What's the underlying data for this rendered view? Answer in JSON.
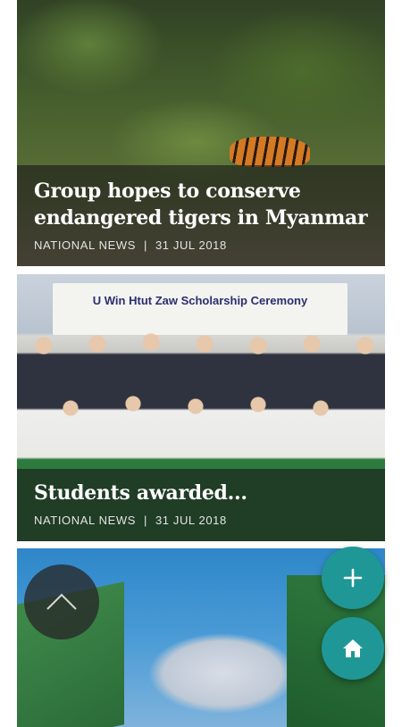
{
  "articles": [
    {
      "title": "Group hopes to conserve endangered tigers in Myanmar",
      "category": "NATIONAL NEWS",
      "separator": "|",
      "date": "31 JUL 2018"
    },
    {
      "title": "Students awarded...",
      "category": "NATIONAL NEWS",
      "separator": "|",
      "date": "31 JUL 2018",
      "image_banner_text": "U Win Htut Zaw Scholarship Ceremony"
    },
    {
      "title": "",
      "category": "",
      "date": ""
    }
  ],
  "controls": {
    "scroll_up_icon": "chevron-up-icon",
    "add_icon": "plus-icon",
    "home_icon": "home-icon"
  },
  "colors": {
    "fab_background": "#1f9796",
    "overlay": "rgba(25,25,25,0.62)",
    "text": "#ffffff"
  }
}
